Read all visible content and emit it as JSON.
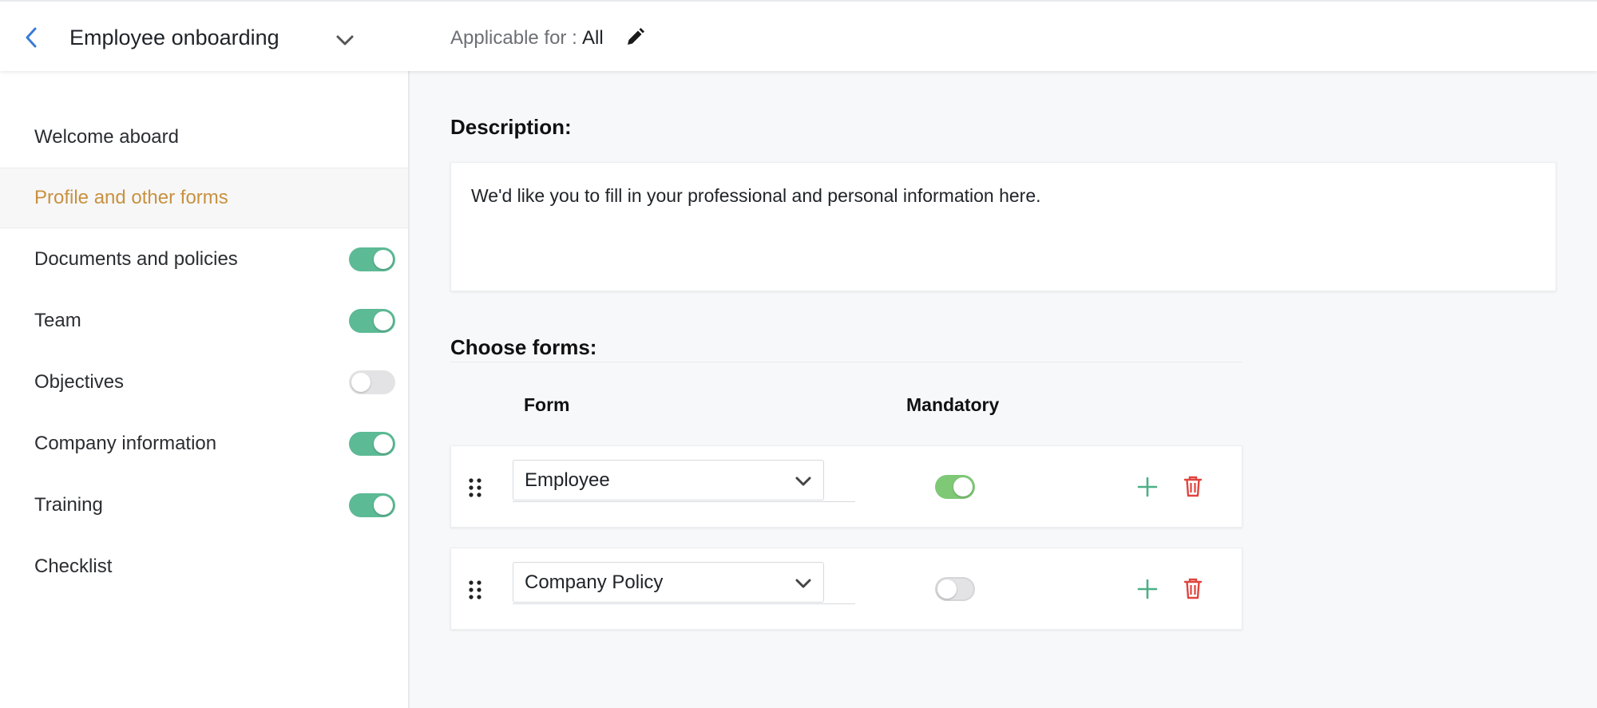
{
  "header": {
    "title": "Employee onboarding",
    "applicable_label": "Applicable for :",
    "applicable_value": "All"
  },
  "sidebar": {
    "items": [
      {
        "label": "Welcome aboard",
        "active": false,
        "toggle": null
      },
      {
        "label": "Profile and other forms",
        "active": true,
        "toggle": null
      },
      {
        "label": "Documents and policies",
        "active": false,
        "toggle": "on"
      },
      {
        "label": "Team",
        "active": false,
        "toggle": "on"
      },
      {
        "label": "Objectives",
        "active": false,
        "toggle": "off"
      },
      {
        "label": "Company information",
        "active": false,
        "toggle": "on"
      },
      {
        "label": "Training",
        "active": false,
        "toggle": "on"
      },
      {
        "label": "Checklist",
        "active": false,
        "toggle": null
      }
    ]
  },
  "main": {
    "description_label": "Description:",
    "description_text": "We'd like you to fill in your professional and personal information here.",
    "choose_forms_label": "Choose forms:",
    "columns": {
      "form": "Form",
      "mandatory": "Mandatory"
    },
    "forms": [
      {
        "name": "Employee",
        "mandatory": true
      },
      {
        "name": "Company Policy",
        "mandatory": false
      }
    ]
  },
  "colors": {
    "accent_active": "#c8913f",
    "toggle_on": "#5cba95",
    "toggle_mandatory_on": "#7fc876",
    "add_icon": "#4caf86",
    "delete_icon": "#e0443e",
    "back_icon": "#3a7bd5"
  }
}
